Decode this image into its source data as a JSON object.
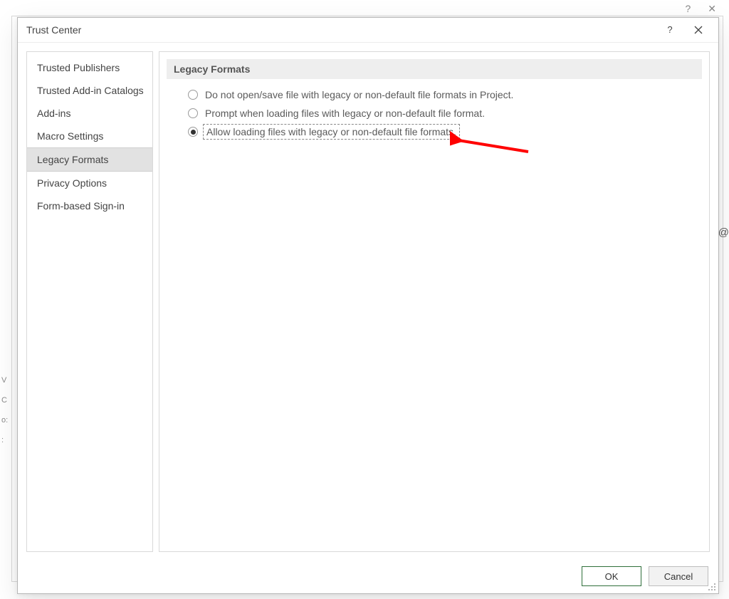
{
  "dialog": {
    "title": "Trust Center",
    "help_tooltip": "?",
    "close_tooltip": "Close"
  },
  "sidebar": {
    "items": [
      {
        "label": "Trusted Publishers",
        "selected": false
      },
      {
        "label": "Trusted Add-in Catalogs",
        "selected": false
      },
      {
        "label": "Add-ins",
        "selected": false
      },
      {
        "label": "Macro Settings",
        "selected": false
      },
      {
        "label": "Legacy Formats",
        "selected": true
      },
      {
        "label": "Privacy Options",
        "selected": false
      },
      {
        "label": "Form-based Sign-in",
        "selected": false
      }
    ]
  },
  "content": {
    "header": "Legacy Formats",
    "options": [
      {
        "label": "Do not open/save file with legacy or non-default file formats in Project.",
        "checked": false
      },
      {
        "label": "Prompt when loading files with legacy or non-default file format.",
        "checked": false
      },
      {
        "label": "Allow loading files with legacy or non-default file formats.",
        "checked": true
      }
    ]
  },
  "footer": {
    "ok": "OK",
    "cancel": "Cancel"
  },
  "backdrop": {
    "v_label": "V",
    "c_label": "C",
    "o_label": "o:",
    "colon_label": ":",
    "at_label": "@"
  }
}
